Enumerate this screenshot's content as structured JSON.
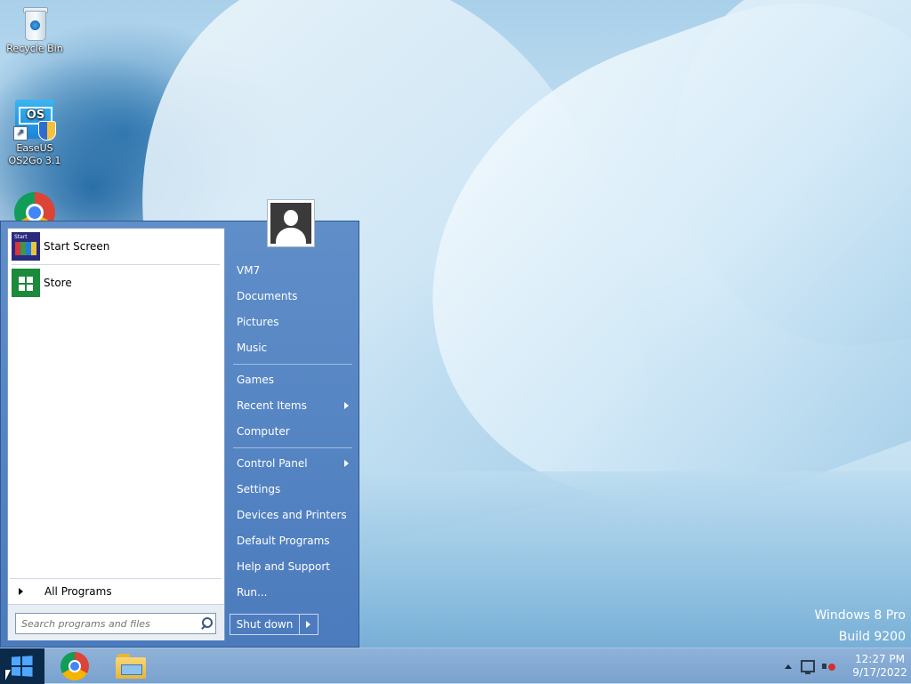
{
  "desktop": {
    "icons": [
      {
        "label": "Recycle Bin",
        "icon": "recycle-bin-icon"
      },
      {
        "label": "EaseUS\nOS2Go 3.1",
        "label_line1": "EaseUS",
        "label_line2": "OS2Go 3.1",
        "icon": "easeus-os2go-icon"
      },
      {
        "label": "",
        "icon": "chrome-icon"
      }
    ],
    "watermark": {
      "line1": "Windows 8 Pro",
      "line2": "Build 9200"
    }
  },
  "start_menu": {
    "pinned": [
      {
        "label": "Start Screen",
        "icon": "start-screen-icon"
      },
      {
        "label": "Store",
        "icon": "store-icon"
      }
    ],
    "all_programs": "All Programs",
    "search_placeholder": "Search programs and files",
    "user": {
      "name": "VM7",
      "icon": "user-avatar-icon"
    },
    "right_items": [
      {
        "label": "Documents"
      },
      {
        "label": "Pictures"
      },
      {
        "label": "Music"
      },
      {
        "label": "Games"
      },
      {
        "label": "Recent Items",
        "submenu": true
      },
      {
        "label": "Computer"
      },
      {
        "label": "Control Panel",
        "submenu": true
      },
      {
        "label": "Settings"
      },
      {
        "label": "Devices and Printers"
      },
      {
        "label": "Default Programs"
      },
      {
        "label": "Help and Support"
      },
      {
        "label": "Run..."
      }
    ],
    "shutdown": "Shut down"
  },
  "taskbar": {
    "pinned": [
      {
        "icon": "windows-start-icon"
      },
      {
        "icon": "chrome-icon"
      },
      {
        "icon": "file-explorer-icon"
      }
    ],
    "tray": {
      "time": "12:27 PM",
      "date": "9/17/2022"
    }
  },
  "colors": {
    "menu_blue": "#5585c5",
    "taskbar": "#86acd6",
    "start_button": "#0b2a4a"
  }
}
